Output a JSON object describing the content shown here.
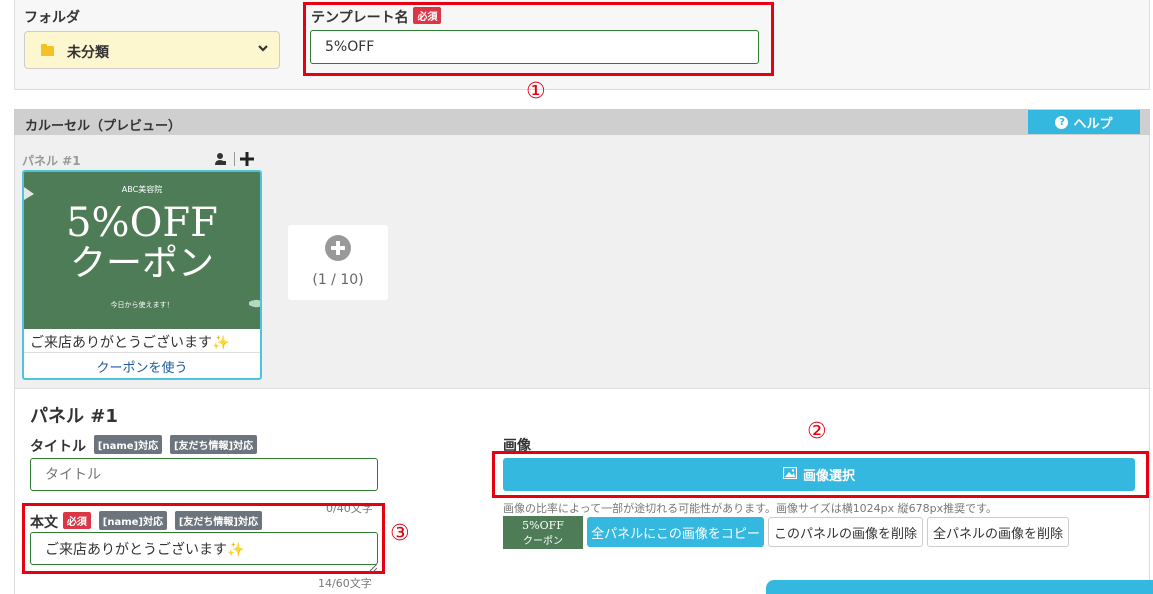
{
  "folder": {
    "label": "フォルダ",
    "selected": "未分類"
  },
  "template": {
    "label": "テンプレート名",
    "required_badge": "必須",
    "value": "5%OFF"
  },
  "markers": {
    "one": "①",
    "two": "②",
    "three": "③"
  },
  "carousel": {
    "header": "カルーセル（プレビュー）",
    "help_label": "ヘルプ",
    "panel_label": "パネル #1",
    "card": {
      "image_small_text": "ABC美容院",
      "image_big_line1": "5%OFF",
      "image_big_line2": "クーポン",
      "image_sub_text": "今日から使えます！",
      "body_text": "ご来店ありがとうございます✨",
      "action_text": "クーポンを使う"
    },
    "add_counter": "(1 / 10)"
  },
  "panel_editor": {
    "heading": "パネル #1",
    "title_label": "タイトル",
    "tag_name": "[name]対応",
    "tag_friend": "[友だち情報]対応",
    "title_placeholder": "タイトル",
    "title_counter": "0/40文字",
    "body_label": "本文",
    "body_required": "必須",
    "body_value": "ご来店ありがとうございます✨",
    "body_counter": "14/60文字",
    "image_label": "画像",
    "image_select_label": "画像選択",
    "image_note": "画像の比率によって一部が途切れる可能性があります。画像サイズは横1024px 縦678px推奨です。",
    "thumb_line1": "5%OFF",
    "thumb_line2": "クーポン",
    "copy_all_label": "全パネルにこの画像をコピー",
    "delete_this_label": "このパネルの画像を削除",
    "delete_all_label": "全パネルの画像を削除"
  },
  "colors": {
    "accent": "#35b8e0",
    "required": "#dc3545",
    "highlight": "#e60012",
    "card_image_bg": "#4d7c57"
  },
  "icons": [
    "folder-icon",
    "chevron-down-icon",
    "question-circle-icon",
    "user-settings-icon",
    "plus-icon",
    "plus-circle-icon",
    "image-icon"
  ]
}
